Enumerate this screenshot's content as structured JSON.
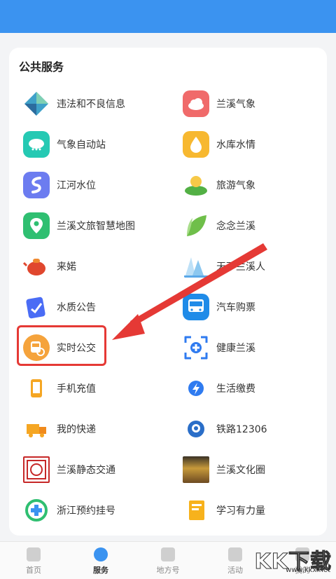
{
  "section": {
    "title": "公共服务"
  },
  "services_left": [
    {
      "label": "违法和不良信息",
      "icon": "diamond-icon"
    },
    {
      "label": "气象自动站",
      "icon": "weather-station-icon"
    },
    {
      "label": "江河水位",
      "icon": "river-icon"
    },
    {
      "label": "兰溪文旅智慧地图",
      "icon": "map-pin-icon"
    },
    {
      "label": "来婼",
      "icon": "teapot-icon"
    },
    {
      "label": "水质公告",
      "icon": "notice-icon"
    },
    {
      "label": "实时公交",
      "icon": "bus-search-icon"
    },
    {
      "label": "手机充值",
      "icon": "phone-icon"
    },
    {
      "label": "我的快递",
      "icon": "truck-icon"
    },
    {
      "label": "兰溪静态交通",
      "icon": "seal-icon"
    },
    {
      "label": "浙江预约挂号",
      "icon": "medical-cross-icon"
    }
  ],
  "services_right": [
    {
      "label": "兰溪气象",
      "icon": "cloud-icon"
    },
    {
      "label": "水库水情",
      "icon": "drop-icon"
    },
    {
      "label": "旅游气象",
      "icon": "sun-island-icon"
    },
    {
      "label": "念念兰溪",
      "icon": "leaf-icon"
    },
    {
      "label": "天下兰溪人",
      "icon": "mountain-icon"
    },
    {
      "label": "汽车购票",
      "icon": "bus-icon"
    },
    {
      "label": "健康兰溪",
      "icon": "health-scan-icon"
    },
    {
      "label": "生活缴费",
      "icon": "lightning-icon"
    },
    {
      "label": "铁路12306",
      "icon": "railway-icon"
    },
    {
      "label": "兰溪文化圈",
      "icon": "city-photo-icon"
    },
    {
      "label": "学习有力量",
      "icon": "book-icon"
    }
  ],
  "nav": {
    "home": "首页",
    "service": "服务",
    "local": "地方号",
    "activity": "活动",
    "mine": "我的"
  },
  "watermark": {
    "brand": "KK下载",
    "url": "www.kkx.net"
  },
  "colors": {
    "accent": "#3b93f0",
    "highlight": "#e53935"
  }
}
